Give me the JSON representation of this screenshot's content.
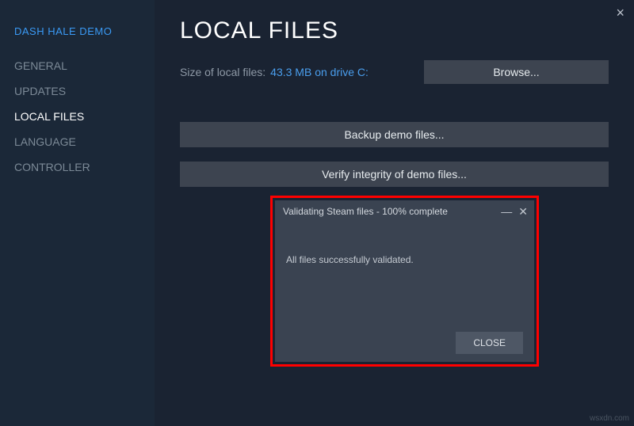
{
  "app_title": "DASH HALE DEMO",
  "nav": {
    "general": "GENERAL",
    "updates": "UPDATES",
    "local_files": "LOCAL FILES",
    "language": "LANGUAGE",
    "controller": "CONTROLLER"
  },
  "page": {
    "title": "LOCAL FILES",
    "size_label": "Size of local files:",
    "size_value": "43.3 MB on drive C:",
    "browse": "Browse...",
    "backup": "Backup demo files...",
    "verify": "Verify integrity of demo files..."
  },
  "dialog": {
    "title": "Validating Steam files - 100% complete",
    "message": "All files successfully validated.",
    "close": "CLOSE"
  },
  "watermark": "wsxdn.com"
}
